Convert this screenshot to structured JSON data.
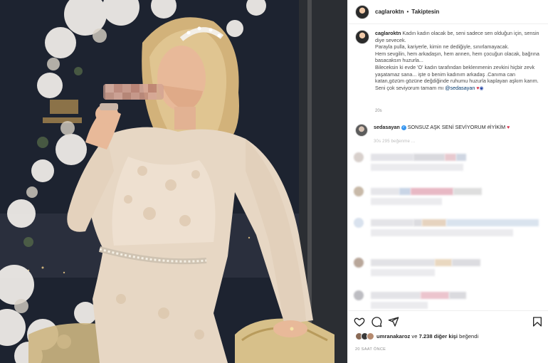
{
  "post": {
    "username": "caglaroktn",
    "separator": "•",
    "follow_status": "Takiptesin"
  },
  "caption": {
    "username": "caglaroktn",
    "lines": [
      "Kadın kadın olacak be, seni sadece sen olduğun için, sensin diye sevecek.",
      "Parayla pulla, kariyerle, kimin ne dediğiyle, sınırlamayacak.",
      "Hem sevgilin, hem arkadaşın, hem annen, hem çocuğun olacak, bağrına basacaksın huzurla...",
      "Bileceksin ki evde 'O' kadın tarafından beklenmenin zevkini hiçbir zevk yaşatamaz sana... işte o benim kadınım arkadaş .Canıma can katan,gözüm gözüne değdiğinde ruhumu huzurla kaplayan aşkım karım. Seni çok seviyorum tamam mı"
    ],
    "mention": "@sedasayan",
    "heart_icon": "red-heart-emoji",
    "nazar_icon": "evil-eye-emoji",
    "age": "20s"
  },
  "comment": {
    "username": "sedasayan",
    "verified_icon": "verified-badge-icon",
    "text": "SONSUZ AŞK SENİ SEVİYORUM #İYİKİM",
    "heart_icon": "red-heart-emoji",
    "meta": "30s   295 beğenme   ..."
  },
  "blurred_comments": [
    {
      "avatar_color": "#d8d0cc",
      "segments": [
        {
          "color": "#e3e3e8"
        },
        {
          "color": "#d9d9de"
        },
        {
          "color": "#e8c9cf"
        },
        {
          "color": "#cfd6e2"
        }
      ]
    },
    {
      "avatar_color": "#c8b9a8",
      "segments": [
        {
          "color": "#e6e6ea"
        },
        {
          "color": "#c9d5e6"
        },
        {
          "color": "#e8b8c4"
        },
        {
          "color": "#dedede"
        }
      ]
    },
    {
      "avatar_color": "#d9e2ee",
      "segments": [
        {
          "color": "#e4e4e8"
        },
        {
          "color": "#dcdce0"
        },
        {
          "color": "#e6d3bf"
        },
        {
          "color": "#d9e3ee"
        }
      ]
    },
    {
      "avatar_color": "#b9a79a",
      "segments": [
        {
          "color": "#e2e2e6"
        },
        {
          "color": "#e9d8c0"
        },
        {
          "color": "#dcdce0"
        }
      ]
    },
    {
      "avatar_color": "#bdbdc2",
      "segments": [
        {
          "color": "#e3e3e7"
        },
        {
          "color": "#ecc4cd"
        },
        {
          "color": "#dadade"
        }
      ]
    }
  ],
  "actions": {
    "like_icon": "heart-outline-icon",
    "comment_icon": "comment-bubble-icon",
    "share_icon": "paper-plane-icon",
    "save_icon": "bookmark-icon"
  },
  "likes": {
    "user": "umranakaroz",
    "connector": "ve",
    "count": "7.238 diğer kişi",
    "suffix": "beğendi"
  },
  "posted_time": "20 SAAT ÖNCE"
}
